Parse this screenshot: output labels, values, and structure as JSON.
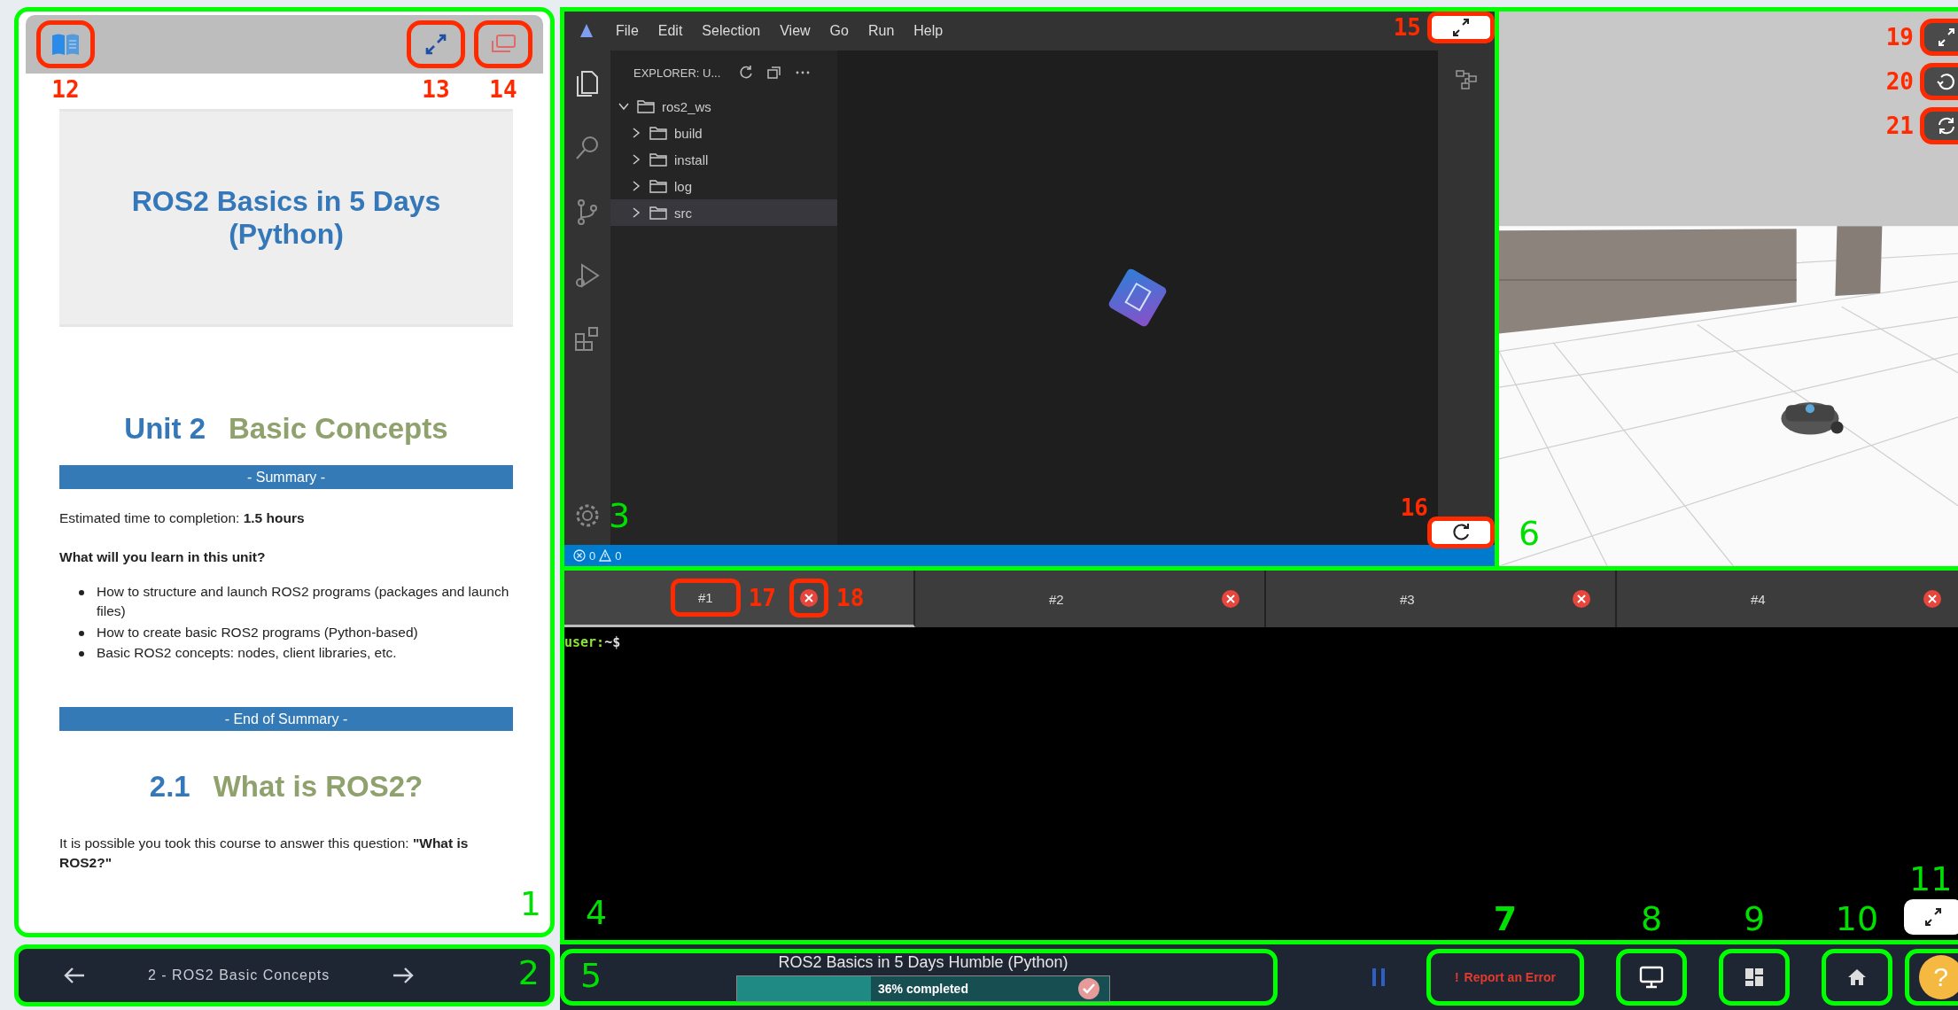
{
  "lesson_panel": {
    "marker": "1",
    "toolbar": [
      {
        "kind": "notebook",
        "marker": "12"
      },
      {
        "kind": "expand",
        "marker": "13"
      },
      {
        "kind": "windows",
        "marker": "14"
      }
    ],
    "course_title": "ROS2 Basics in 5 Days (Python)",
    "unit_number": "Unit 2",
    "unit_title": "Basic Concepts",
    "summary_bar": "- Summary -",
    "estimate": "Estimated time to completion: **1.5 hours**",
    "learn_heading": "What will you learn in this unit?",
    "bullets": [
      "How to structure and launch ROS2 programs (packages and launch files)",
      "How to create basic ROS2 programs (Python-based)",
      "Basic ROS2 concepts: nodes, client libraries, etc."
    ],
    "end_bar": "- End of Summary -",
    "section_number": "2.1",
    "section_title": "What is ROS2?",
    "paragraph": "It is possible you took this course to answer this question: **\"What is ROS2?\"**"
  },
  "lesson_nav": {
    "marker": "2",
    "label": "2 - ROS2 Basic Concepts"
  },
  "ide": {
    "marker": "3",
    "menu": [
      "File",
      "Edit",
      "Selection",
      "View",
      "Go",
      "Run",
      "Help"
    ],
    "explorer_title": "EXPLORER: U...",
    "tree": {
      "label": "ros2_ws",
      "expanded": true,
      "children": [
        {
          "label": "build",
          "expanded": false,
          "selected": false
        },
        {
          "label": "install",
          "expanded": false,
          "selected": false
        },
        {
          "label": "log",
          "expanded": false,
          "selected": false
        },
        {
          "label": "src",
          "expanded": false,
          "selected": true
        }
      ]
    },
    "status": {
      "errors": "0",
      "warnings": "0"
    },
    "buttons": [
      {
        "kind": "expand",
        "marker": "15"
      },
      {
        "kind": "reload",
        "marker": "16"
      }
    ]
  },
  "simulation": {
    "marker": "6",
    "buttons": [
      {
        "kind": "expand",
        "marker": "19"
      },
      {
        "kind": "reset",
        "marker": "20"
      },
      {
        "kind": "refresh",
        "marker": "21"
      }
    ]
  },
  "terminal": {
    "marker": "4",
    "tabs": [
      {
        "label": "#1",
        "selected": true,
        "marker": "17",
        "close_marker": "18"
      },
      {
        "label": "#2",
        "selected": false
      },
      {
        "label": "#3",
        "selected": false
      },
      {
        "label": "#4",
        "selected": false
      }
    ],
    "prompt_user": "user:",
    "prompt_path": "~$",
    "expand_marker": "11"
  },
  "footer": {
    "marker": "5",
    "course": "ROS2 Basics in 5 Days Humble (Python)",
    "progress": {
      "level": 0.36,
      "label": "36% completed"
    },
    "buttons": [
      {
        "kind": "pause"
      },
      {
        "kind": "report",
        "icon": "!",
        "label": "Report an Error",
        "marker": "7"
      },
      {
        "kind": "display",
        "marker": "8"
      },
      {
        "kind": "grid",
        "marker": "9"
      },
      {
        "kind": "home",
        "marker": "10"
      },
      {
        "kind": "help",
        "label": "?"
      }
    ]
  }
}
